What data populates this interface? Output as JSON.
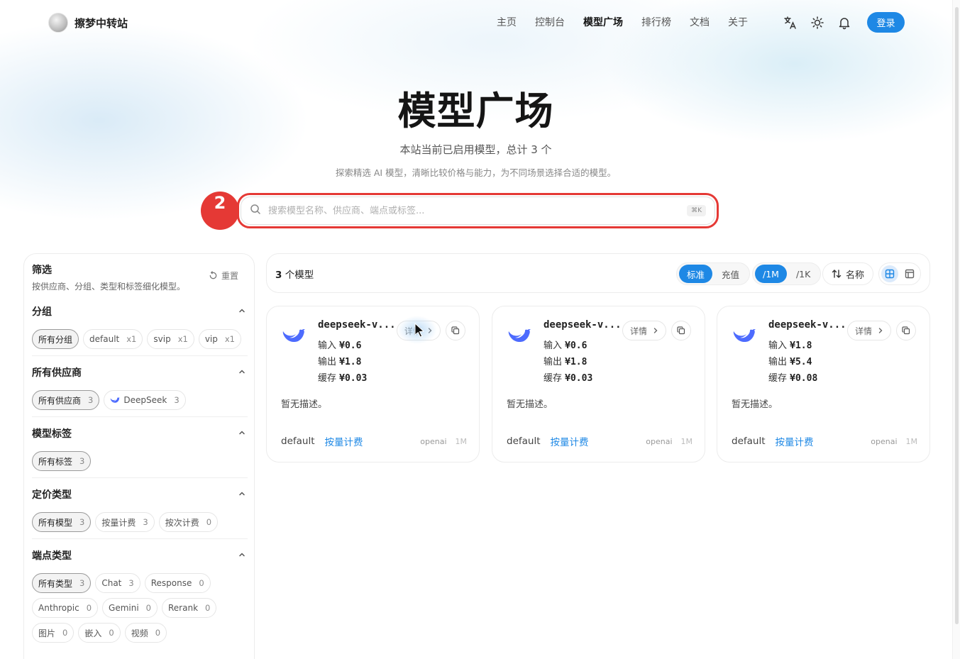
{
  "brand": {
    "name": "擦梦中转站"
  },
  "nav": {
    "items": [
      {
        "label": "主页",
        "active": false
      },
      {
        "label": "控制台",
        "active": false
      },
      {
        "label": "模型广场",
        "active": true
      },
      {
        "label": "排行榜",
        "active": false
      },
      {
        "label": "文档",
        "active": false
      },
      {
        "label": "关于",
        "active": false
      }
    ],
    "icons": [
      "translate-icon",
      "sun-icon",
      "bell-icon"
    ],
    "login_label": "登录"
  },
  "hero": {
    "title": "模型广场",
    "subtitle": "本站当前已启用模型，总计 3 个",
    "description": "探索精选 AI 模型，清晰比较价格与能力，为不同场景选择合适的模型。"
  },
  "search": {
    "placeholder": "搜索模型名称、供应商、端点或标签...",
    "shortcut": "⌘K",
    "annotation_number": "2"
  },
  "sidebar": {
    "title": "筛选",
    "description": "按供应商、分组、类型和标签细化模型。",
    "reset_label": "重置",
    "sections": [
      {
        "title": "分组",
        "chips": [
          {
            "label": "所有分组",
            "count": "",
            "active": true
          },
          {
            "label": "default",
            "count": "x1",
            "active": false
          },
          {
            "label": "svip",
            "count": "x1",
            "active": false
          },
          {
            "label": "vip",
            "count": "x1",
            "active": false
          }
        ]
      },
      {
        "title": "所有供应商",
        "chips": [
          {
            "label": "所有供应商",
            "count": "3",
            "active": true
          },
          {
            "label": "DeepSeek",
            "count": "3",
            "active": false
          }
        ]
      },
      {
        "title": "模型标签",
        "chips": [
          {
            "label": "所有标签",
            "count": "3",
            "active": true
          }
        ]
      },
      {
        "title": "定价类型",
        "chips": [
          {
            "label": "所有模型",
            "count": "3",
            "active": true
          },
          {
            "label": "按量计费",
            "count": "3",
            "active": false
          },
          {
            "label": "按次计费",
            "count": "0",
            "active": false
          }
        ]
      },
      {
        "title": "端点类型",
        "chips": [
          {
            "label": "所有类型",
            "count": "3",
            "active": true
          },
          {
            "label": "Chat",
            "count": "3",
            "active": false
          },
          {
            "label": "Response",
            "count": "0",
            "active": false
          },
          {
            "label": "Anthropic",
            "count": "0",
            "active": false
          },
          {
            "label": "Gemini",
            "count": "0",
            "active": false
          },
          {
            "label": "Rerank",
            "count": "0",
            "active": false
          },
          {
            "label": "图片",
            "count": "0",
            "active": false
          },
          {
            "label": "嵌入",
            "count": "0",
            "active": false
          },
          {
            "label": "视频",
            "count": "0",
            "active": false
          }
        ]
      }
    ]
  },
  "toolbar": {
    "count_number": "3",
    "count_suffix": " 个模型",
    "price_mode": [
      "标准",
      "充值"
    ],
    "price_unit": [
      "/1M",
      "/1K"
    ],
    "sort_label": "名称"
  },
  "cards": [
    {
      "name": "deepseek-v...",
      "detail_label": "详情",
      "prices": [
        {
          "label": "输入",
          "value": "¥0.6"
        },
        {
          "label": "输出",
          "value": "¥1.8"
        },
        {
          "label": "缓存",
          "value": "¥0.03"
        }
      ],
      "description": "暂无描述。",
      "group": "default",
      "billing": "按量计费",
      "endpoint": "openai",
      "unit": "1M"
    },
    {
      "name": "deepseek-v...",
      "detail_label": "详情",
      "prices": [
        {
          "label": "输入",
          "value": "¥0.6"
        },
        {
          "label": "输出",
          "value": "¥1.8"
        },
        {
          "label": "缓存",
          "value": "¥0.03"
        }
      ],
      "description": "暂无描述。",
      "group": "default",
      "billing": "按量计费",
      "endpoint": "openai",
      "unit": "1M"
    },
    {
      "name": "deepseek-v...",
      "detail_label": "详情",
      "prices": [
        {
          "label": "输入",
          "value": "¥1.8"
        },
        {
          "label": "输出",
          "value": "¥5.4"
        },
        {
          "label": "缓存",
          "value": "¥0.08"
        }
      ],
      "description": "暂无描述。",
      "group": "default",
      "billing": "按量计费",
      "endpoint": "openai",
      "unit": "1M"
    }
  ],
  "colors": {
    "accent": "#1e88e5",
    "annotation": "#e53935",
    "deepseek": "#4d6bfe"
  }
}
